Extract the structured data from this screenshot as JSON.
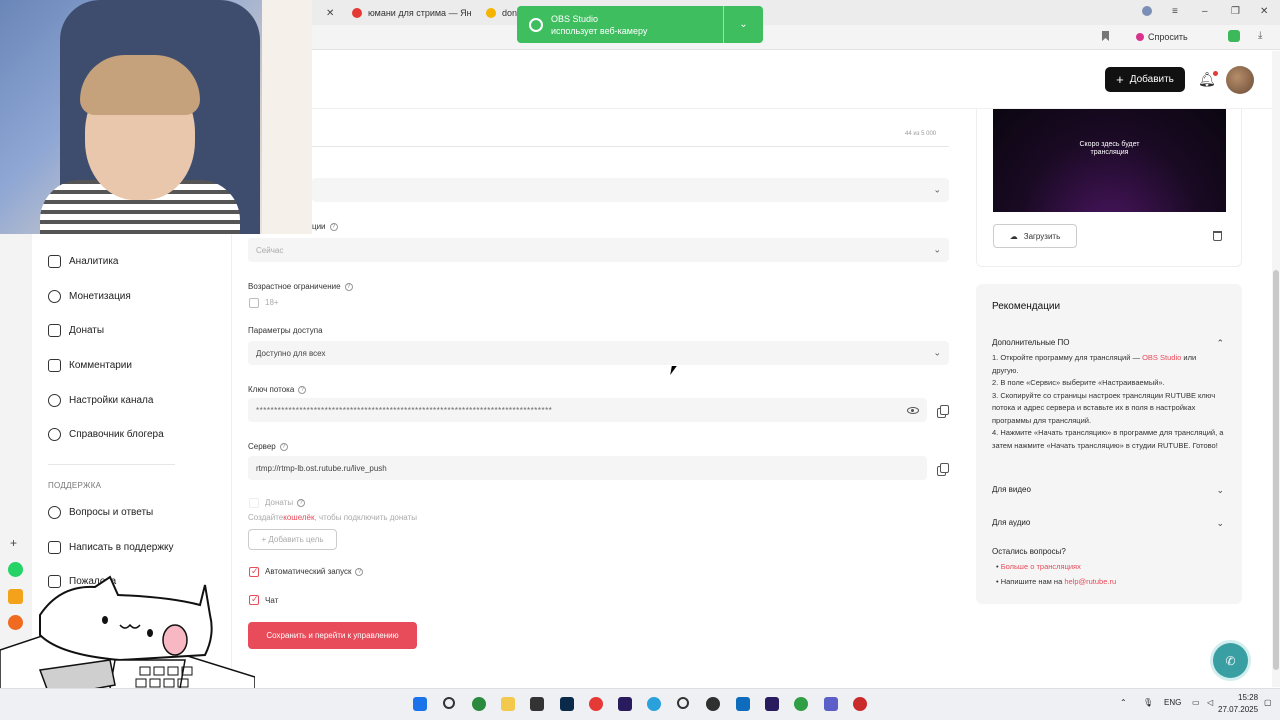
{
  "browser": {
    "tab1_title": "юмани для стрима — Ян",
    "tab2_title": "don",
    "ask_label": "Спросить"
  },
  "toast": {
    "title": "OBS Studio",
    "message": "использует веб-камеру"
  },
  "header": {
    "add_label": "Добавить"
  },
  "sidebar": {
    "items": [
      {
        "label": "Аналитика",
        "icon": "chart-icon"
      },
      {
        "label": "Монетизация",
        "icon": "ruble-icon"
      },
      {
        "label": "Донаты",
        "icon": "donate-icon"
      },
      {
        "label": "Комментарии",
        "icon": "comment-icon"
      },
      {
        "label": "Настройки канала",
        "icon": "gear-icon"
      },
      {
        "label": "Справочник блогера",
        "icon": "book-icon"
      }
    ],
    "support_section": "ПОДДЕРЖКА",
    "support_items": [
      {
        "label": "Вопросы и ответы",
        "icon": "question-icon"
      },
      {
        "label": "Написать в поддержку",
        "icon": "mail-icon"
      },
      {
        "label": "Пожалова",
        "icon": "flag-icon"
      }
    ]
  },
  "form": {
    "char_counter": "44 из 5 000",
    "publish_label_partial": "ции",
    "publish_value": "Сейчас",
    "age_label": "Возрастное ограничение",
    "age_option": "18+",
    "access_label": "Параметры доступа",
    "access_value": "Доступно для всех",
    "stream_key_label": "Ключ потока",
    "stream_key_value": "**********************************************************************************",
    "server_label": "Сервер",
    "server_value": "rtmp://rtmp-lb.ost.rutube.ru/live_push",
    "donations_label": "Донаты",
    "donations_hint_prefix": "Создайте ",
    "donations_hint_link": "кошелёк",
    "donations_hint_suffix": ", чтобы подключить донаты",
    "add_goal_label": "+ Добавить цель",
    "auto_start_label": "Автоматический запуск",
    "chat_label": "Чат",
    "submit_label": "Сохранить и перейти к управлению"
  },
  "preview": {
    "placeholder_line1": "Скоро здесь будет",
    "placeholder_line2": "трансляция",
    "upload_label": "Загрузить"
  },
  "recommendations": {
    "title": "Рекомендации",
    "extra_software": "Дополнительные ПО",
    "step1_prefix": "1. Откройте программу для трансляций — ",
    "step1_link": "OBS Studio",
    "step1_suffix": " или другую.",
    "step2": "2. В поле «Сервис» выберите «Настраиваемый».",
    "step3": "3. Скопируйте со страницы настроек трансляции RUTUBE ключ потока и адрес сервера и вставьте их в поля в настройках программы для трансляций.",
    "step4": "4. Нажмите «Начать трансляцию» в программе для трансляций, а затем нажмите «Начать трансляцию» в студии RUTUBE. Готово!",
    "for_video": "Для видео",
    "for_audio": "Для аудио",
    "questions_title": "Остались вопросы?",
    "more_link": "Больше о трансляциях",
    "write_prefix": "Напишите нам на ",
    "email": "help@rutube.ru"
  },
  "taskbar": {
    "lang": "ENG",
    "time": "15:28",
    "date": "27.07.2025"
  },
  "colors": {
    "accent": "#e84b5a",
    "toast": "#3fbe60",
    "fab": "#3a9fa3"
  }
}
